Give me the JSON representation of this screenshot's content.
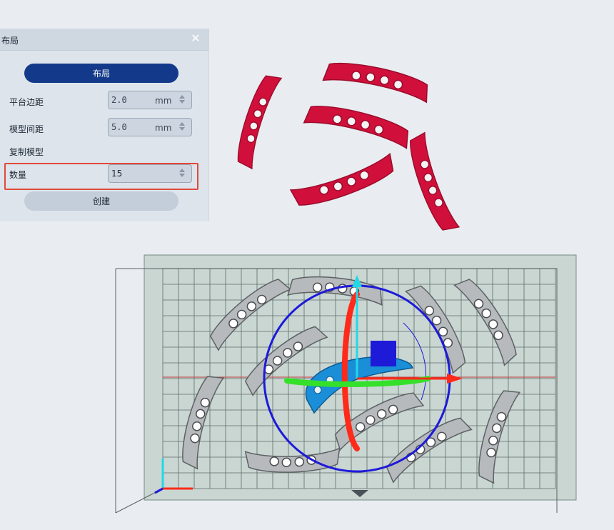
{
  "panel": {
    "title": "布局",
    "close_icon": "✕",
    "layout_button": "布局",
    "platform_margin": {
      "label": "平台边距",
      "value": "2.0",
      "unit": "mm"
    },
    "model_spacing": {
      "label": "模型间距",
      "value": "5.0",
      "unit": "mm"
    },
    "copy_section": "复制模型",
    "quantity": {
      "label": "数量",
      "value": "15"
    },
    "create_button": "创建"
  },
  "colors": {
    "accent": "#133a8a",
    "highlight": "#e04a3b",
    "model_red": "#d0103a",
    "model_selected": "#1a8fd8",
    "gizmo_blue": "#1d1ad8",
    "gizmo_red": "#ff2a1a",
    "gizmo_green": "#35e02a",
    "gizmo_cyan": "#22d8e6",
    "plate": "#c9d6d2"
  },
  "icons": [
    "close-icon",
    "spin-up-icon",
    "spin-down-icon",
    "axis-gizmo-icon",
    "camera-arrow-icon"
  ]
}
